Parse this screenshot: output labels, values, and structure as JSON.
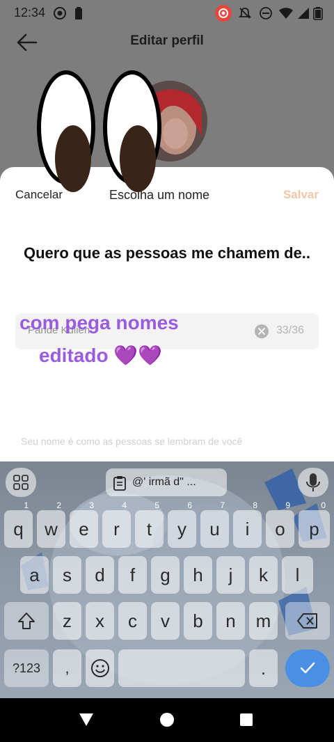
{
  "status_bar": {
    "time": "12:34"
  },
  "header": {
    "title": "Editar perfil",
    "background_text": "perfil"
  },
  "sheet": {
    "cancel_label": "Cancelar",
    "title": "Escolha um nome",
    "save_label": "Salvar",
    "prompt": "Quero que as pessoas me chamem de..",
    "name_value": "Pande Kdlien",
    "char_count": "33/36",
    "overlay_line1": "com pega nomes",
    "overlay_line2": "editado 💜💜",
    "helper_text": "Seu nome é como as pessoas se lembram de você",
    "accent_color": "#f4c6a8",
    "overlay_color": "#9a5be0"
  },
  "keyboard": {
    "clipboard_text": "@' irmã d\" ...",
    "row1": [
      {
        "key": "q",
        "hint": "1"
      },
      {
        "key": "w",
        "hint": "2"
      },
      {
        "key": "e",
        "hint": "3"
      },
      {
        "key": "r",
        "hint": "4"
      },
      {
        "key": "t",
        "hint": "5"
      },
      {
        "key": "y",
        "hint": "6"
      },
      {
        "key": "u",
        "hint": "7"
      },
      {
        "key": "i",
        "hint": "8"
      },
      {
        "key": "o",
        "hint": "9"
      },
      {
        "key": "p",
        "hint": "0"
      }
    ],
    "row2": [
      "a",
      "s",
      "d",
      "f",
      "g",
      "h",
      "j",
      "k",
      "l"
    ],
    "row3": [
      "z",
      "x",
      "c",
      "v",
      "b",
      "n",
      "m"
    ],
    "symbols_key": "?123",
    "comma_key": ",",
    "period_key": ".",
    "icons": [
      "apps-grid-icon",
      "clipboard-icon",
      "mic-icon",
      "shift-icon",
      "backspace-icon",
      "emoji-icon",
      "check-icon"
    ]
  },
  "nav": {
    "icons": [
      "back-triangle-icon",
      "home-circle-icon",
      "recents-square-icon"
    ]
  }
}
